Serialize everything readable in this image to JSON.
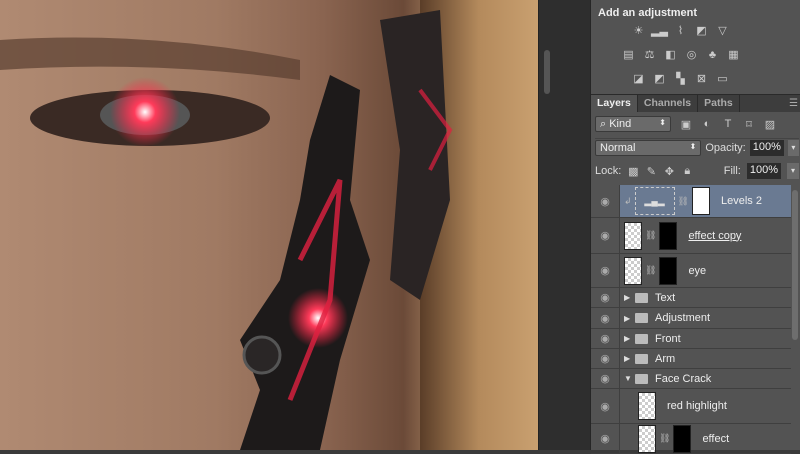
{
  "adjustments": {
    "title": "Add an adjustment",
    "row1": [
      "brightness-contrast-icon",
      "levels-icon",
      "curves-icon",
      "exposure-icon",
      "vibrance-icon"
    ],
    "row2": [
      "hue-saturation-icon",
      "color-balance-icon",
      "black-white-icon",
      "photo-filter-icon",
      "channel-mixer-icon",
      "color-lookup-icon"
    ],
    "row3": [
      "invert-icon",
      "posterize-icon",
      "threshold-icon",
      "selective-color-icon",
      "gradient-map-icon"
    ]
  },
  "tabs": [
    "Layers",
    "Channels",
    "Paths"
  ],
  "filter": {
    "kind": "Kind"
  },
  "blend": {
    "mode": "Normal",
    "opacity_label": "Opacity:",
    "opacity": "100%"
  },
  "lock": {
    "label": "Lock:",
    "fill_label": "Fill:",
    "fill": "100%"
  },
  "layers": [
    {
      "name": "Levels 2",
      "type": "adjustment",
      "selected": true
    },
    {
      "name": "effect copy",
      "type": "pixel-mask"
    },
    {
      "name": "eye",
      "type": "pixel-mask"
    },
    {
      "name": "Text",
      "type": "group"
    },
    {
      "name": "Adjustment",
      "type": "group"
    },
    {
      "name": "Front",
      "type": "group"
    },
    {
      "name": "Arm",
      "type": "group"
    },
    {
      "name": "Face Crack",
      "type": "group-open"
    },
    {
      "name": "red highlight",
      "type": "pixel"
    },
    {
      "name": "effect",
      "type": "pixel-mask"
    }
  ]
}
